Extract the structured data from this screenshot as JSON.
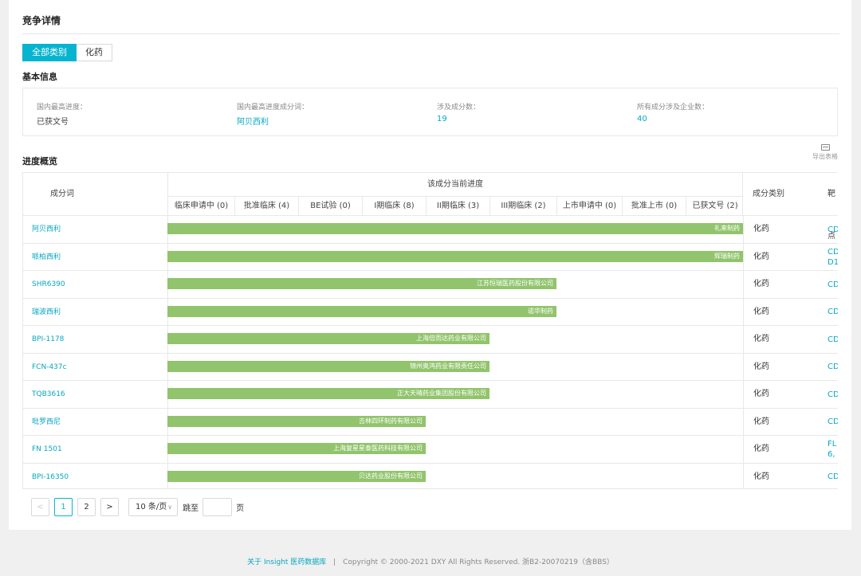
{
  "page_title": "竞争详情",
  "tabs": [
    {
      "label": "全部类别",
      "active": true
    },
    {
      "label": "化药",
      "active": false
    }
  ],
  "basic_info": {
    "heading": "基本信息",
    "items": [
      {
        "label": "国内最高进度：",
        "value": "已获文号"
      },
      {
        "label": "国内最高进度成分词：",
        "value": "阿贝西利"
      },
      {
        "label": "涉及成分数：",
        "value": "19"
      },
      {
        "label": "所有成分涉及企业数：",
        "value": "40"
      }
    ]
  },
  "progress": {
    "heading": "进度概览",
    "export_label": "导出表格",
    "col_name": "成分词",
    "col_progress": "该成分当前进度",
    "col_category": "成分类别",
    "col_target": "靶点",
    "phases": [
      "临床申请中 (0)",
      "批准临床 (4)",
      "BE试验 (0)",
      "I期临床 (8)",
      "II期临床 (3)",
      "III期临床 (2)",
      "上市申请中 (0)",
      "批准上市 (0)",
      "已获文号 (2)"
    ],
    "rows": [
      {
        "name": "阿贝西利",
        "company": "礼来制药",
        "phase_reached": 9,
        "category": "化药",
        "target": [
          "CD"
        ]
      },
      {
        "name": "哌柏西利",
        "company": "辉瑞制药",
        "phase_reached": 9,
        "category": "化药",
        "target": [
          "CD",
          "D1"
        ]
      },
      {
        "name": "SHR6390",
        "company": "江苏恒瑞医药股份有限公司",
        "phase_reached": 6,
        "category": "化药",
        "target": [
          "CD"
        ]
      },
      {
        "name": "瑞波西利",
        "company": "诺华制药",
        "phase_reached": 6,
        "category": "化药",
        "target": [
          "CD"
        ]
      },
      {
        "name": "BPI-1178",
        "company": "上海倍而达药业有限公司",
        "phase_reached": 5,
        "category": "化药",
        "target": [
          "CD"
        ]
      },
      {
        "name": "FCN-437c",
        "company": "锦州奥鸿药业有限责任公司",
        "phase_reached": 5,
        "category": "化药",
        "target": [
          "CD"
        ]
      },
      {
        "name": "TQB3616",
        "company": "正大天晴药业集团股份有限公司",
        "phase_reached": 5,
        "category": "化药",
        "target": [
          "CD"
        ]
      },
      {
        "name": "吡罗西尼",
        "company": "吉林四环制药有限公司",
        "phase_reached": 4,
        "category": "化药",
        "target": [
          "CD"
        ]
      },
      {
        "name": "FN 1501",
        "company": "上海复星星泰医药科技有限公司",
        "phase_reached": 4,
        "category": "化药",
        "target": [
          "FL",
          "6,"
        ]
      },
      {
        "name": "BPI-16350",
        "company": "贝达药业股份有限公司",
        "phase_reached": 4,
        "category": "化药",
        "target": [
          "CD"
        ]
      }
    ]
  },
  "pagination": {
    "prev": "<",
    "pages": [
      "1",
      "2"
    ],
    "current": "1",
    "next": ">",
    "page_size": "10 条/页",
    "jump_label": "跳至",
    "page_suffix": "页"
  },
  "footer": {
    "link_text": "关于 Insight 医药数据库",
    "separator": "|",
    "copyright": "Copyright © 2000-2021 DXY All Rights Reserved. 浙B2-20070219（含BBS）"
  },
  "colors": {
    "accent": "#06b4cf",
    "bar": "#91c46c",
    "link": "#06a7c2"
  }
}
